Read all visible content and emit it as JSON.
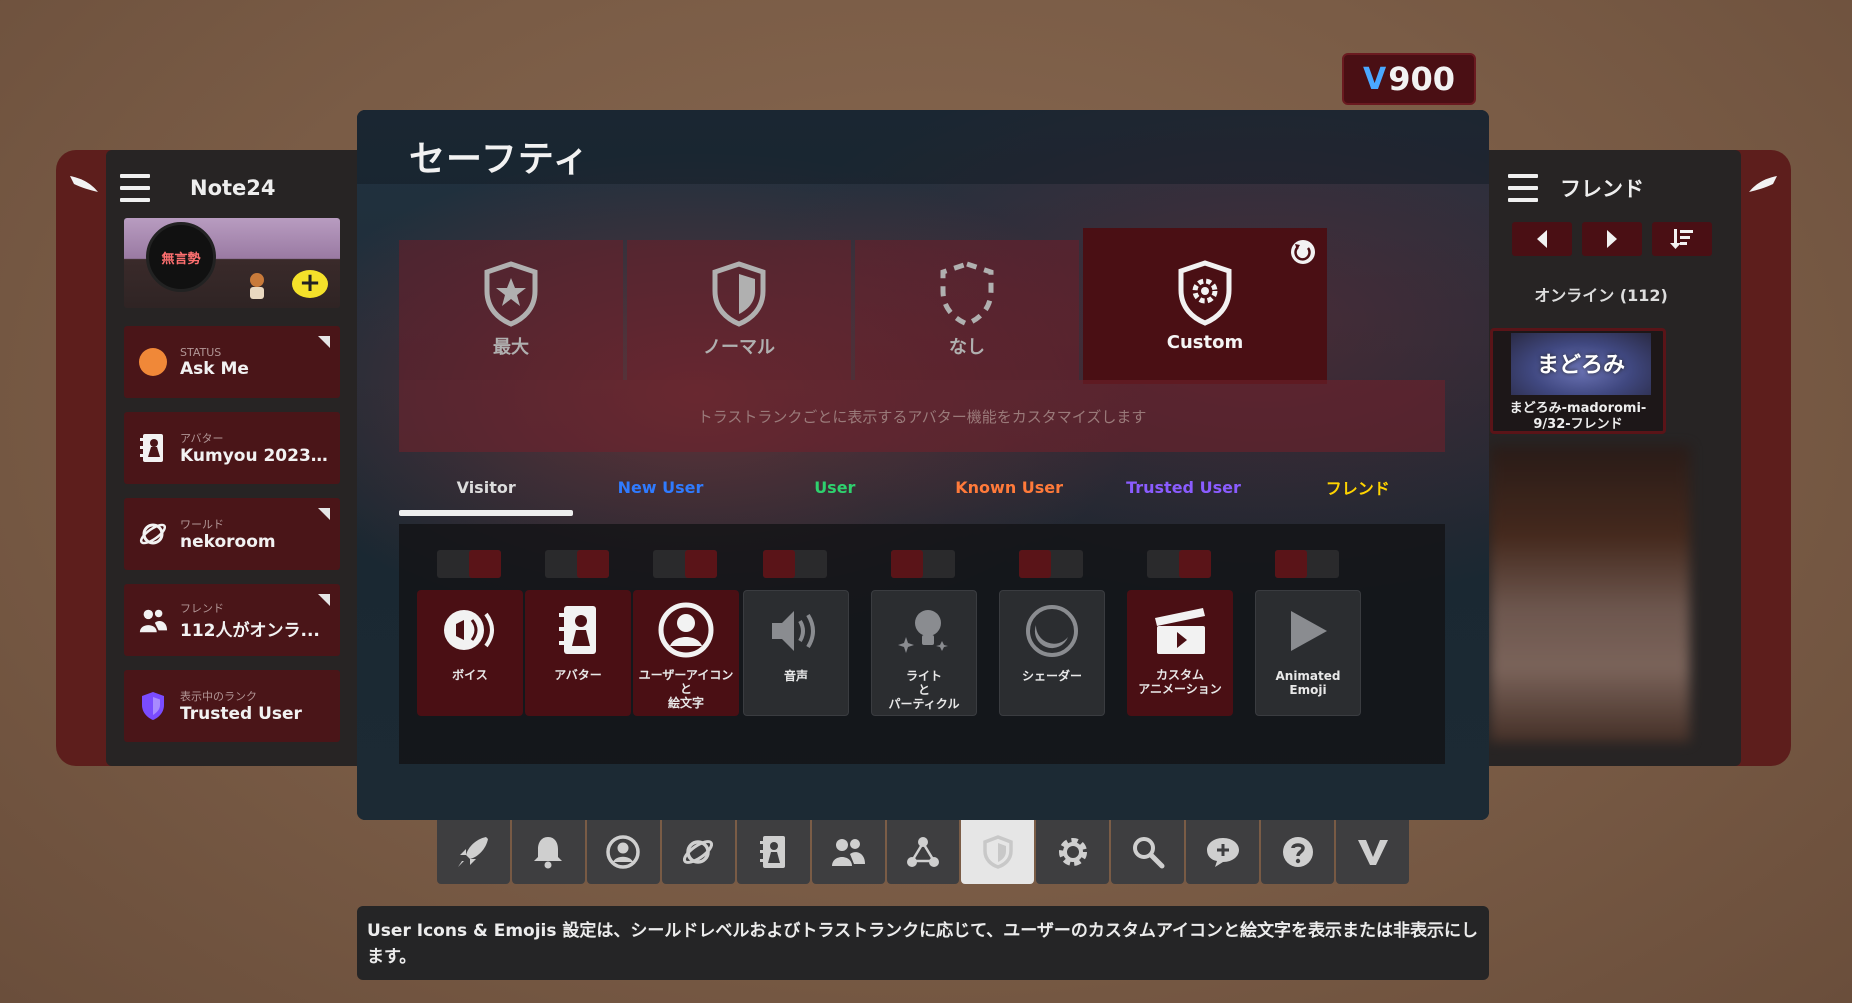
{
  "credits": {
    "symbol": "V",
    "amount": "900"
  },
  "left_panel": {
    "title": "Note24",
    "profile": {
      "avatar_text": "無言勢"
    },
    "cards": [
      {
        "label": "STATUS",
        "value": "Ask Me",
        "icon": "status-dot-orange",
        "has_menu": true
      },
      {
        "label": "アバター",
        "value": "Kumyou 2023-...",
        "icon": "avatar-book-icon",
        "has_menu": false
      },
      {
        "label": "ワールド",
        "value": "nekoroom",
        "icon": "planet-icon",
        "has_menu": true
      },
      {
        "label": "フレンド",
        "value": "112人がオンラ...",
        "icon": "friends-icon",
        "has_menu": true
      },
      {
        "label": "表示中のランク",
        "value": "Trusted User",
        "icon": "shield-icon",
        "has_menu": false
      }
    ]
  },
  "right_panel": {
    "title": "フレンド",
    "online": "オンライン (112)",
    "friend": {
      "thumb_text": "まどろみ",
      "name_line1": "まどろみ-madoromi-",
      "name_line2": "9/32-フレンド"
    }
  },
  "main": {
    "title": "セーフティ",
    "levels": [
      {
        "name": "最大",
        "icon": "shield-star-icon",
        "active": false
      },
      {
        "name": "ノーマル",
        "icon": "shield-icon",
        "active": false
      },
      {
        "name": "なし",
        "icon": "shield-dashed-icon",
        "active": false
      },
      {
        "name": "Custom",
        "icon": "shield-gear-icon",
        "active": true
      }
    ],
    "description": "トラストランクごとに表示するアバター機能をカスタマイズします",
    "tabs": [
      {
        "label": "Visitor",
        "color": "#dcdcdc",
        "active": true
      },
      {
        "label": "New User",
        "color": "#2f7bff",
        "active": false
      },
      {
        "label": "User",
        "color": "#2ed16e",
        "active": false
      },
      {
        "label": "Known User",
        "color": "#ff7a3a",
        "active": false
      },
      {
        "label": "Trusted User",
        "color": "#8a5cff",
        "active": false
      },
      {
        "label": "フレンド",
        "color": "#ffd400",
        "active": false
      }
    ],
    "permissions": [
      {
        "label": "ボイス",
        "icon": "voice-icon",
        "on": true
      },
      {
        "label": "アバター",
        "icon": "avatar-icon",
        "on": true
      },
      {
        "label": "ユーザーアイコン\nと\n絵文字",
        "icon": "user-icon",
        "on": true
      },
      {
        "label": "音声",
        "icon": "speaker-icon",
        "on": false
      },
      {
        "label": "ライト\nと\nパーティクル",
        "icon": "light-particle-icon",
        "on": false
      },
      {
        "label": "シェーダー",
        "icon": "shader-icon",
        "on": false
      },
      {
        "label": "カスタム\nアニメーション",
        "icon": "clapper-icon",
        "on": true
      },
      {
        "label": "Animated\nEmoji",
        "icon": "play-icon",
        "on": false
      }
    ]
  },
  "dock": [
    {
      "name": "rocket-icon",
      "active": false
    },
    {
      "name": "bell-icon",
      "active": false
    },
    {
      "name": "profile-icon",
      "active": false
    },
    {
      "name": "planet-icon",
      "active": false
    },
    {
      "name": "avatar-book-icon",
      "active": false
    },
    {
      "name": "friends-icon",
      "active": false
    },
    {
      "name": "network-icon",
      "active": false
    },
    {
      "name": "shield-icon",
      "active": true
    },
    {
      "name": "gear-icon",
      "active": false
    },
    {
      "name": "search-icon",
      "active": false
    },
    {
      "name": "chat-icon",
      "active": false
    },
    {
      "name": "help-icon",
      "active": false
    },
    {
      "name": "vrchat-icon",
      "active": false
    }
  ],
  "tooltip": "User Icons & Emojis 設定は、シールドレベルおよびトラストランクに応じて、ユーザーのカスタムアイコンと絵文字を表示または非表示にします。"
}
